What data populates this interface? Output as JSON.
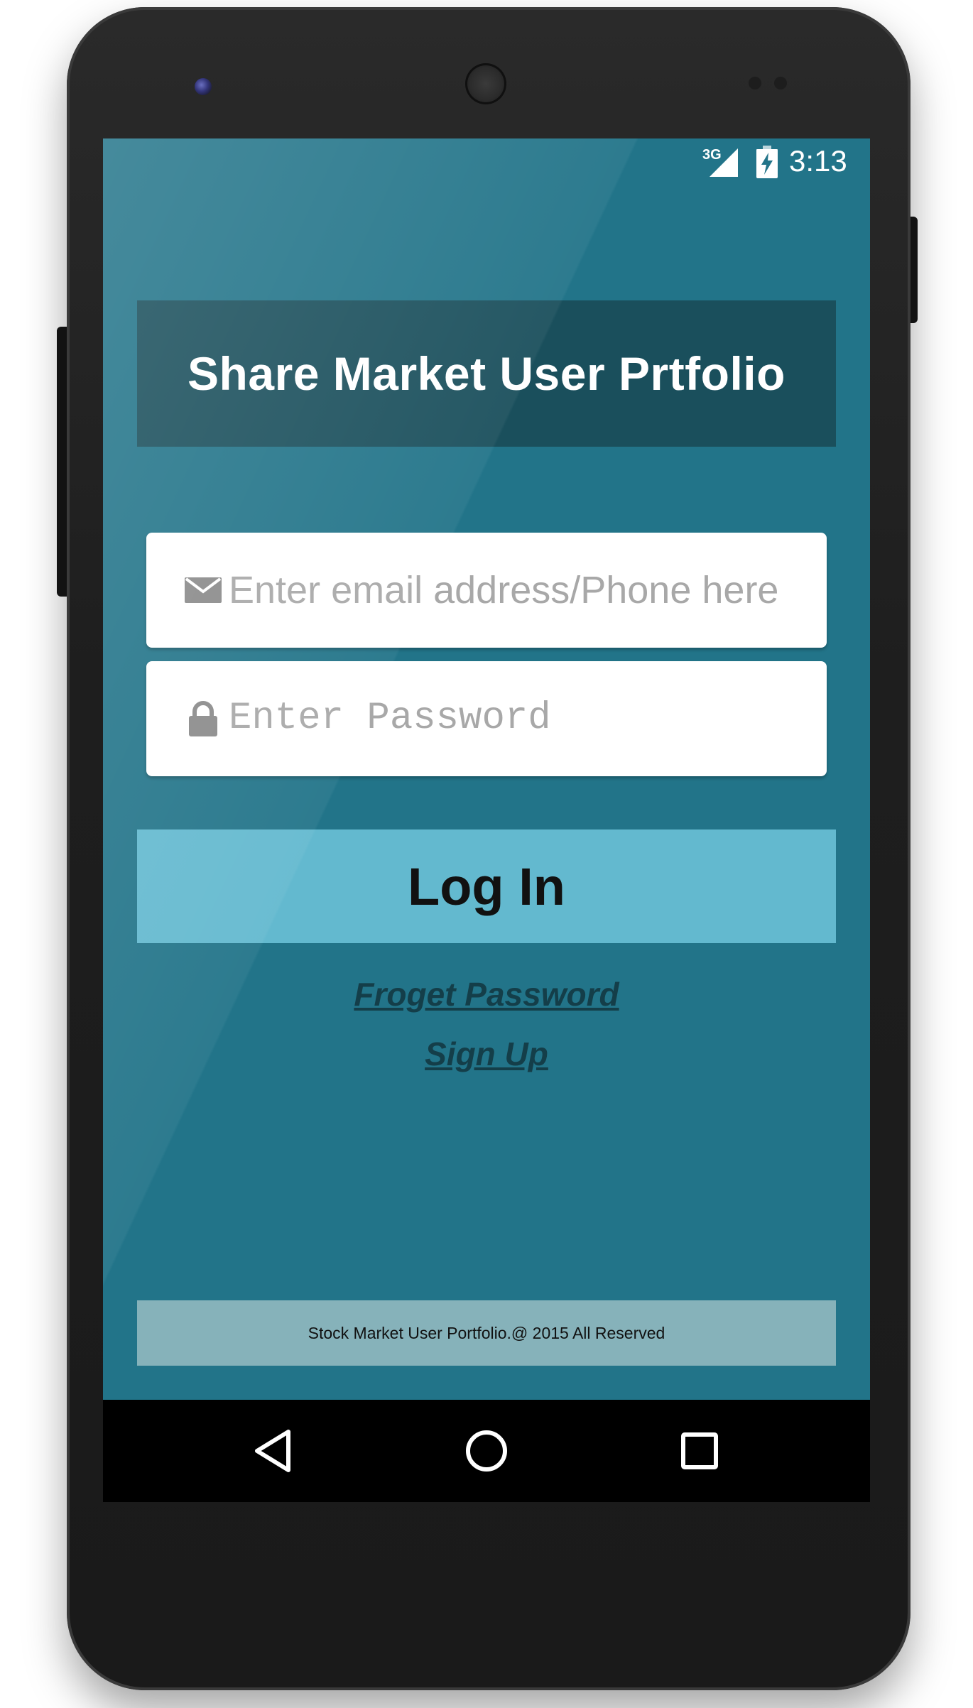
{
  "status_bar": {
    "network": "3G",
    "time": "3:13"
  },
  "app": {
    "title": "Share Market User Prtfolio"
  },
  "form": {
    "email_placeholder": "Enter email address/Phone here",
    "password_placeholder": "Enter Password",
    "login_label": "Log In",
    "forgot_password_label": "Froget Password",
    "sign_up_label": "Sign Up"
  },
  "footer": {
    "text": "Stock Market User Portfolio.@ 2015 All Reserved"
  },
  "icons": {
    "email": "email-icon",
    "password": "lock-icon",
    "signal": "signal-icon",
    "battery": "battery-charging-icon",
    "nav_back": "back-icon",
    "nav_home": "home-icon",
    "nav_recents": "recents-icon"
  },
  "colors": {
    "screen_background": "#227489",
    "title_bar": "#1a4f5c",
    "login_button": "#63b9cf",
    "footer": "#86b2ba",
    "link": "#143e49"
  }
}
